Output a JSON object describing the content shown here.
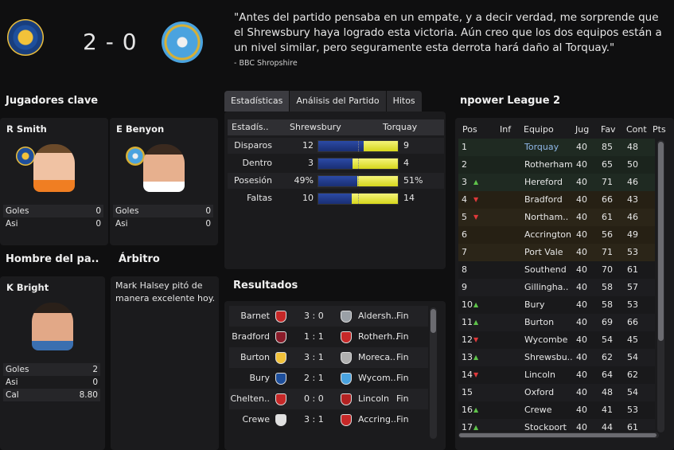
{
  "match": {
    "score": "2 - 0",
    "quote": "\"Antes del partido pensaba en un empate, y a decir verdad, me sorprende que el Shrewsbury haya logrado esta victoria. Aún creo que los dos equipos están a un nivel similar, pero seguramente esta derrota hará daño al Torquay.\"",
    "quote_source": "- BBC Shropshire"
  },
  "key_players": {
    "title": "Jugadores clave",
    "players": [
      {
        "name": "R Smith",
        "stats": [
          {
            "label": "Goles",
            "value": "0"
          },
          {
            "label": "Asi",
            "value": "0"
          }
        ]
      },
      {
        "name": "E Benyon",
        "stats": [
          {
            "label": "Goles",
            "value": "0"
          },
          {
            "label": "Asi",
            "value": "0"
          }
        ]
      }
    ]
  },
  "motm": {
    "title": "Hombre del pa..",
    "name": "K Bright",
    "stats": [
      {
        "label": "Goles",
        "value": "2"
      },
      {
        "label": "Asi",
        "value": "0"
      },
      {
        "label": "Cal",
        "value": "8.80"
      }
    ]
  },
  "referee": {
    "title": "Árbitro",
    "text": "Mark Halsey pitó de manera excelente hoy."
  },
  "tabs": [
    "Estadísticas",
    "Análisis del Partido",
    "Hitos"
  ],
  "match_stats": {
    "header": {
      "label": "Estadís..",
      "home": "Shrewsbury",
      "away": "Torquay"
    },
    "rows": [
      {
        "label": "Disparos",
        "home": "12",
        "away": "9",
        "home_share": 0.57
      },
      {
        "label": "Dentro",
        "home": "3",
        "away": "4",
        "home_share": 0.43
      },
      {
        "label": "Posesión",
        "home": "49%",
        "away": "51%",
        "home_share": 0.49
      },
      {
        "label": "Faltas",
        "home": "10",
        "away": "14",
        "home_share": 0.42
      }
    ]
  },
  "results": {
    "title": "Resultados",
    "rows": [
      {
        "home": "Barnet",
        "score": "3 : 0",
        "away": "Aldersh..",
        "status": "Fin"
      },
      {
        "home": "Bradford",
        "score": "1 : 1",
        "away": "Rotherh..",
        "status": "Fin"
      },
      {
        "home": "Burton",
        "score": "3 : 1",
        "away": "Moreca..",
        "status": "Fin"
      },
      {
        "home": "Bury",
        "score": "2 : 1",
        "away": "Wycom..",
        "status": "Fin"
      },
      {
        "home": "Chelten..",
        "score": "0 : 0",
        "away": "Lincoln",
        "status": "Fin"
      },
      {
        "home": "Crewe",
        "score": "3 : 1",
        "away": "Accring..",
        "status": "Fin"
      }
    ]
  },
  "league": {
    "title": "npower League 2",
    "columns": [
      "Pos",
      "Inf",
      "Equipo",
      "Jug",
      "Fav",
      "Cont",
      "Pts"
    ],
    "rows": [
      {
        "pos": "1",
        "inf": "",
        "team": "Torquay",
        "jug": "40",
        "fav": "85",
        "cont": "48"
      },
      {
        "pos": "2",
        "inf": "",
        "team": "Rotherham",
        "jug": "40",
        "fav": "65",
        "cont": "50"
      },
      {
        "pos": "3",
        "inf": "up",
        "team": "Hereford",
        "jug": "40",
        "fav": "71",
        "cont": "46"
      },
      {
        "pos": "4",
        "inf": "down",
        "team": "Bradford",
        "jug": "40",
        "fav": "66",
        "cont": "43"
      },
      {
        "pos": "5",
        "inf": "down",
        "team": "Northam..",
        "jug": "40",
        "fav": "61",
        "cont": "46"
      },
      {
        "pos": "6",
        "inf": "",
        "team": "Accrington",
        "jug": "40",
        "fav": "56",
        "cont": "49"
      },
      {
        "pos": "7",
        "inf": "",
        "team": "Port Vale",
        "jug": "40",
        "fav": "71",
        "cont": "53"
      },
      {
        "pos": "8",
        "inf": "",
        "team": "Southend",
        "jug": "40",
        "fav": "70",
        "cont": "61"
      },
      {
        "pos": "9",
        "inf": "",
        "team": "Gillingha..",
        "jug": "40",
        "fav": "58",
        "cont": "57"
      },
      {
        "pos": "10",
        "inf": "up",
        "team": "Bury",
        "jug": "40",
        "fav": "58",
        "cont": "53"
      },
      {
        "pos": "11",
        "inf": "up",
        "team": "Burton",
        "jug": "40",
        "fav": "69",
        "cont": "66"
      },
      {
        "pos": "12",
        "inf": "down",
        "team": "Wycombe",
        "jug": "40",
        "fav": "54",
        "cont": "45"
      },
      {
        "pos": "13",
        "inf": "up",
        "team": "Shrewsbu..",
        "jug": "40",
        "fav": "62",
        "cont": "54"
      },
      {
        "pos": "14",
        "inf": "down",
        "team": "Lincoln",
        "jug": "40",
        "fav": "64",
        "cont": "62"
      },
      {
        "pos": "15",
        "inf": "",
        "team": "Oxford",
        "jug": "40",
        "fav": "48",
        "cont": "54"
      },
      {
        "pos": "16",
        "inf": "up",
        "team": "Crewe",
        "jug": "40",
        "fav": "41",
        "cont": "53"
      },
      {
        "pos": "17",
        "inf": "up",
        "team": "Stockport",
        "jug": "40",
        "fav": "44",
        "cont": "61"
      }
    ]
  },
  "colors": {
    "home_bar": "#2b4aa6",
    "away_bar": "#e6e62a",
    "promotion": "#1f2a22",
    "playoff": "#2b2518",
    "leader_text": "#8fb7e8"
  }
}
